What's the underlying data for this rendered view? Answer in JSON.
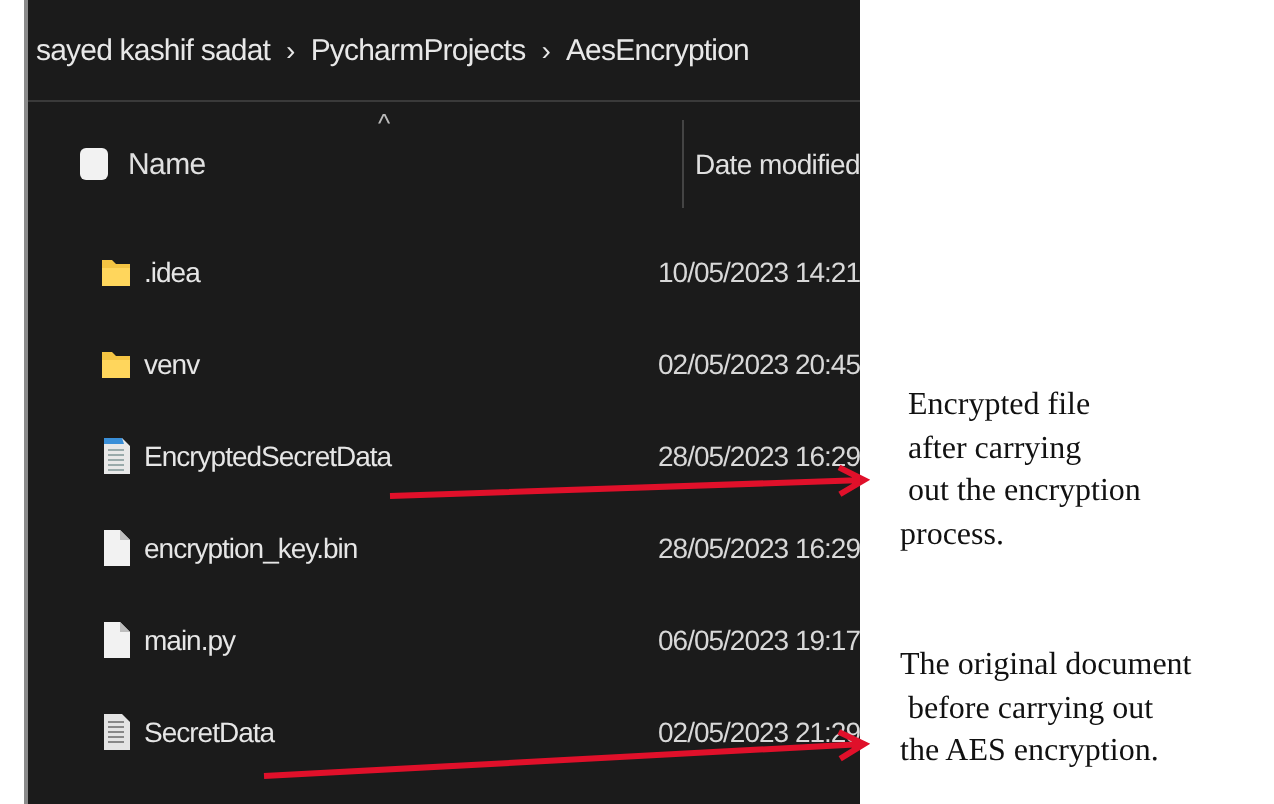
{
  "breadcrumb": [
    "sayed kashif sadat",
    "PycharmProjects",
    "AesEncryption"
  ],
  "breadcrumb_separator": "›",
  "select_all": {
    "checked": false
  },
  "columns": [
    {
      "label": "Name"
    },
    {
      "label": "Date modified"
    }
  ],
  "sort_caret": "^",
  "files": [
    {
      "name": ".idea",
      "kind": "folder",
      "date_modified": "10/05/2023 14:21"
    },
    {
      "name": "venv",
      "kind": "folder",
      "date_modified": "02/05/2023 20:45"
    },
    {
      "name": "EncryptedSecretData",
      "kind": "document",
      "date_modified": "28/05/2023 16:29"
    },
    {
      "name": "encryption_key.bin",
      "kind": "file",
      "date_modified": "28/05/2023 16:29"
    },
    {
      "name": "main.py",
      "kind": "file",
      "date_modified": "06/05/2023 19:17"
    },
    {
      "name": "SecretData",
      "kind": "text",
      "date_modified": "02/05/2023 21:29"
    }
  ],
  "annotations": [
    {
      "text": " Encrypted file\n after carrying\n out the encryption\nprocess."
    },
    {
      "text": "The original document\n before carrying out\nthe AES encryption."
    }
  ]
}
